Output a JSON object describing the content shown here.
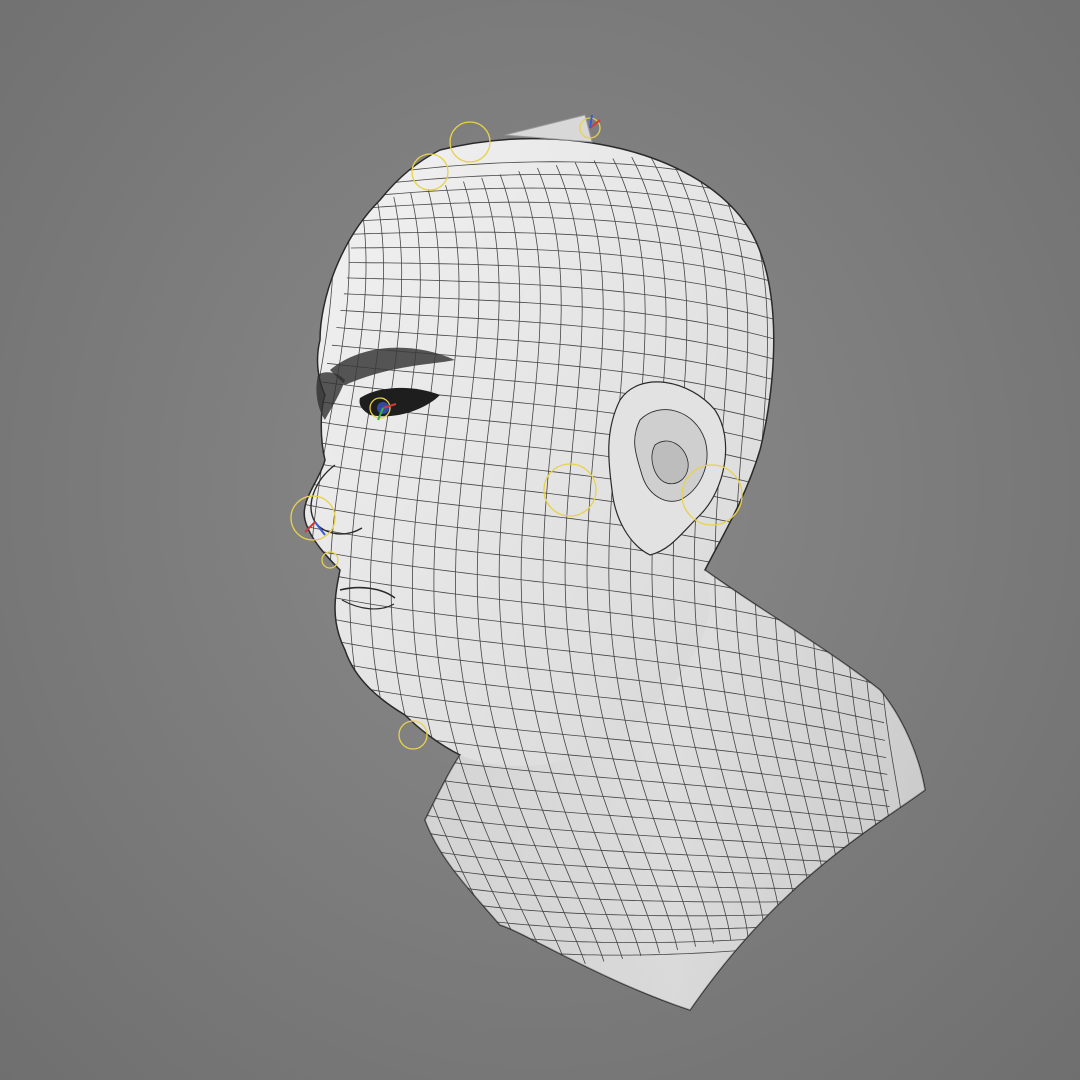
{
  "viewport": {
    "background_color": "#7e7e7e",
    "render_mode": "shaded-wireframe"
  },
  "model": {
    "subject": "head-bust",
    "surface_color": "#e6e6e6",
    "wireframe_color": "#2a2a2a"
  },
  "rig_controls": {
    "color": "#e8d24a",
    "axis_colors": [
      "#d23a3a",
      "#3ab04a",
      "#3a5ad2"
    ],
    "icon": "circle-control-icon"
  }
}
